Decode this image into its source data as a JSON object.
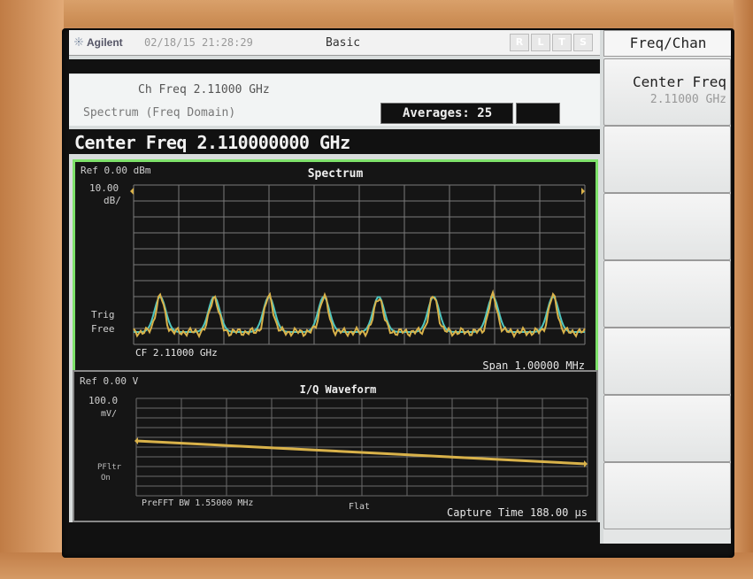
{
  "header": {
    "brand": "Agilent",
    "datetime": "02/18/15 21:28:29",
    "mode": "Basic",
    "indicators": [
      "R",
      "L",
      "T",
      "S"
    ]
  },
  "info": {
    "channel_freq": "Ch Freq 2.11000 GHz",
    "measurement": "Spectrum (Freq Domain)",
    "averages_label": "Averages: 25"
  },
  "center_freq_bar": "Center Freq  2.110000000 GHz",
  "spectrum": {
    "title": "Spectrum",
    "ref_level": "Ref 0.00 dBm",
    "scale_value": "10.00",
    "scale_unit": "dB/",
    "trig_line1": "Trig",
    "trig_line2": "Free",
    "cf_label": "CF 2.11000 GHz",
    "span_label": "Span 1.00000 MHz",
    "trace_yellow": "#d9b24a",
    "trace_cyan": "#4fc7c1",
    "border": "#7ee26a"
  },
  "waveform": {
    "title": "I/Q Waveform",
    "ref_level": "Ref 0.00 V",
    "scale_value": "100.0",
    "scale_unit": "mV/",
    "offset_line1": "PFltr",
    "offset_line2": "On",
    "prefft_label": "PreFFT BW 1.55000 MHz",
    "filter_label": "Flat",
    "capture_label": "Capture Time 188.00 µs"
  },
  "softkeys": {
    "panel_title": "Freq/Chan",
    "center_freq_label": "Center Freq",
    "center_freq_value": "2.11000 GHz"
  }
}
